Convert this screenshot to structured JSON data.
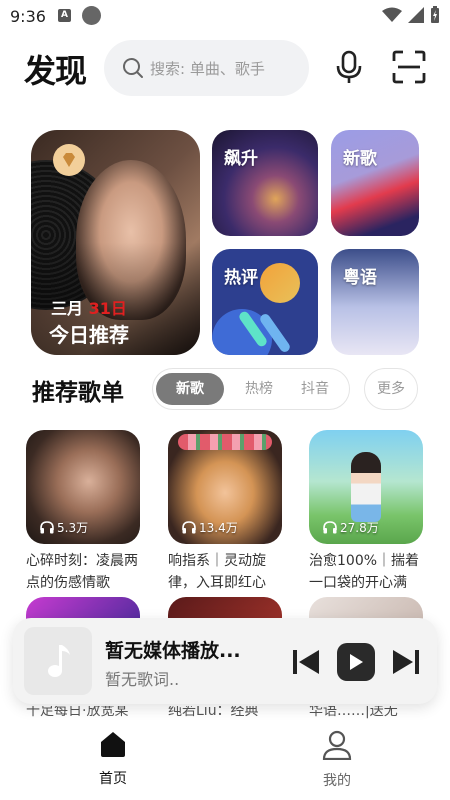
{
  "status_bar": {
    "time": "9:36"
  },
  "header": {
    "title": "发现",
    "search_placeholder": "搜索: 单曲、歌手"
  },
  "hero": {
    "date_month": "三月",
    "date_day": "31日",
    "label": "今日推荐"
  },
  "tiles": [
    {
      "label": "飙升"
    },
    {
      "label": "新歌"
    },
    {
      "label": "热评"
    },
    {
      "label": "粤语"
    }
  ],
  "playlist_section": {
    "title": "推荐歌单",
    "tabs": [
      {
        "label": "新歌"
      },
      {
        "label": "热榜"
      },
      {
        "label": "抖音"
      }
    ],
    "more": "更多"
  },
  "playlists": [
    {
      "plays": "5.3万",
      "name": "心碎时刻：凌晨两点的伤感情歌"
    },
    {
      "plays": "13.4万",
      "name": "响指系｜灵动旋律，入耳即红心"
    },
    {
      "plays": "27.8万",
      "name": "治愈100%｜揣着一口袋的开心满"
    }
  ],
  "playlists_row2_peek": [
    "十足每日·放宽某",
    "纯若Liu：经典",
    "华语……|送无"
  ],
  "player": {
    "title": "暂无媒体播放...",
    "subtitle": "暂无歌词.."
  },
  "bottom_nav": [
    {
      "label": "首页"
    },
    {
      "label": "我的"
    }
  ],
  "colors": {
    "accent_red": "#e02020",
    "active_tab": "#7a7a7a"
  }
}
